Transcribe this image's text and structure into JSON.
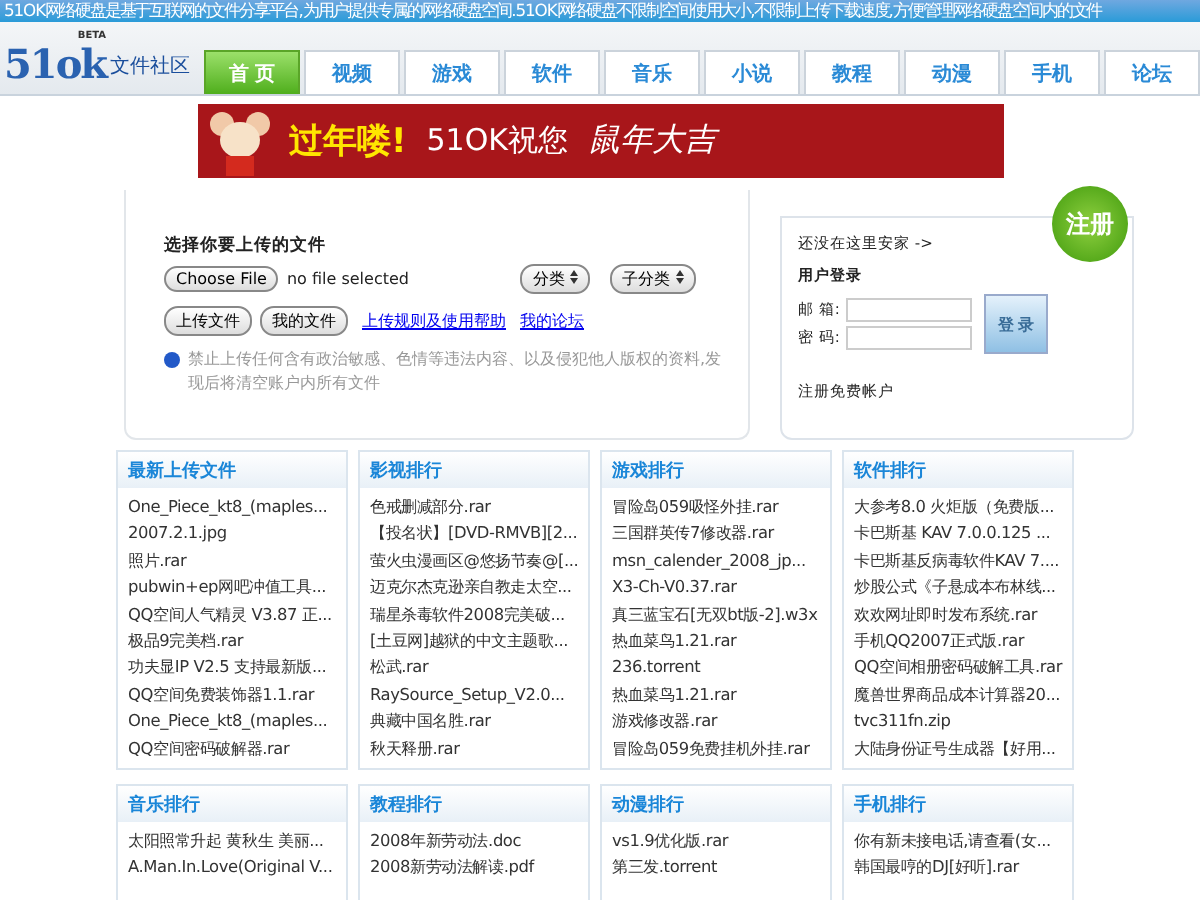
{
  "top_bar": {
    "text": "51OK网络硬盘是基于互联网的文件分享平台,为用户提供专属的网络硬盘空间.51OK网络硬盘不限制空间使用大小,不限制上传下载速度,方便管理网络硬盘空间内的文件"
  },
  "logo": {
    "text": "51ok",
    "beta": "BETA",
    "subtitle": "文件社区"
  },
  "nav_tabs": [
    {
      "label": "首 页",
      "selected": true
    },
    {
      "label": "视频",
      "selected": false
    },
    {
      "label": "游戏",
      "selected": false
    },
    {
      "label": "软件",
      "selected": false
    },
    {
      "label": "音乐",
      "selected": false
    },
    {
      "label": "小说",
      "selected": false
    },
    {
      "label": "教程",
      "selected": false
    },
    {
      "label": "动漫",
      "selected": false
    },
    {
      "label": "手机",
      "selected": false
    },
    {
      "label": "论坛",
      "selected": false
    }
  ],
  "banner": {
    "greeting": "过年喽!",
    "wish": "51OK祝您",
    "blessing": "鼠年大吉"
  },
  "upload": {
    "title": "选择你要上传的文件",
    "file_button": "Choose File",
    "file_status": "no file selected",
    "category": "分类",
    "subcategory": "子分类",
    "upload_button": "上传文件",
    "my_files_button": "我的文件",
    "links": [
      "上传规则及使用帮助",
      "我的论坛"
    ],
    "notice": "禁止上传任何含有政治敏感、色情等违法内容、以及侵犯他人版权的资料,发现后将清空账户内所有文件"
  },
  "login": {
    "prompt": "还没在这里安家 ->",
    "badge": "注册",
    "title": "用户登录",
    "email_label": "邮 箱:",
    "password_label": "密 码:",
    "submit": "登 录",
    "register_link": "注册免费帐户"
  },
  "sections": [
    {
      "title": "最新上传文件",
      "items": [
        "One_Piece_kt8_(maples...",
        "2007.2.1.jpg",
        "照片.rar",
        "pubwin+ep网吧冲值工具...",
        "QQ空间人气精灵 V3.87 正...",
        "极品9完美档.rar",
        "功夫显IP V2.5 支持最新版...",
        "QQ空间免费装饰器1.1.rar",
        "One_Piece_kt8_(maples...",
        "QQ空间密码破解器.rar"
      ]
    },
    {
      "title": "影视排行",
      "items": [
        "色戒删减部分.rar",
        "【投名状】[DVD-RMVB][2...",
        "萤火虫漫画区@悠扬节奏@[...",
        "迈克尔杰克逊亲自教走太空...",
        "瑞星杀毒软件2008完美破...",
        "[土豆网]越狱的中文主题歌...",
        "松武.rar",
        "RaySource_Setup_V2.0...",
        "典藏中国名胜.rar",
        "秋天释册.rar"
      ]
    },
    {
      "title": "游戏排行",
      "items": [
        "冒险岛059吸怪外挂.rar",
        "三国群英传7修改器.rar",
        "msn_calender_2008_jp...",
        "X3-Ch-V0.37.rar",
        "真三蓝宝石[无双bt版-2].w3x",
        "热血菜鸟1.21.rar",
        "236.torrent",
        "热血菜鸟1.21.rar",
        "游戏修改器.rar",
        "冒险岛059免费挂机外挂.rar"
      ]
    },
    {
      "title": "软件排行",
      "items": [
        "大参考8.0 火炬版（免费版...",
        "卡巴斯基 KAV 7.0.0.125 ...",
        "卡巴斯基反病毒软件KAV 7....",
        "炒股公式《子悬成本布林线...",
        "欢欢网址即时发布系统.rar",
        "手机QQ2007正式版.rar",
        "QQ空间相册密码破解工具.rar",
        "魔兽世界商品成本计算器20...",
        "tvc311fn.zip",
        "大陆身份证号生成器【好用..."
      ]
    },
    {
      "title": "音乐排行",
      "items": [
        "太阳照常升起 黄秋生 美丽...",
        "A.Man.In.Love(Original V..."
      ]
    },
    {
      "title": "教程排行",
      "items": [
        "2008年新劳动法.doc",
        "2008新劳动法解读.pdf"
      ]
    },
    {
      "title": "动漫排行",
      "items": [
        "vs1.9优化版.rar",
        "第三发.torrent"
      ]
    },
    {
      "title": "手机排行",
      "items": [
        "你有新未接电话,请查看(女...",
        "韩国最哼的DJ[好听].rar"
      ]
    }
  ]
}
